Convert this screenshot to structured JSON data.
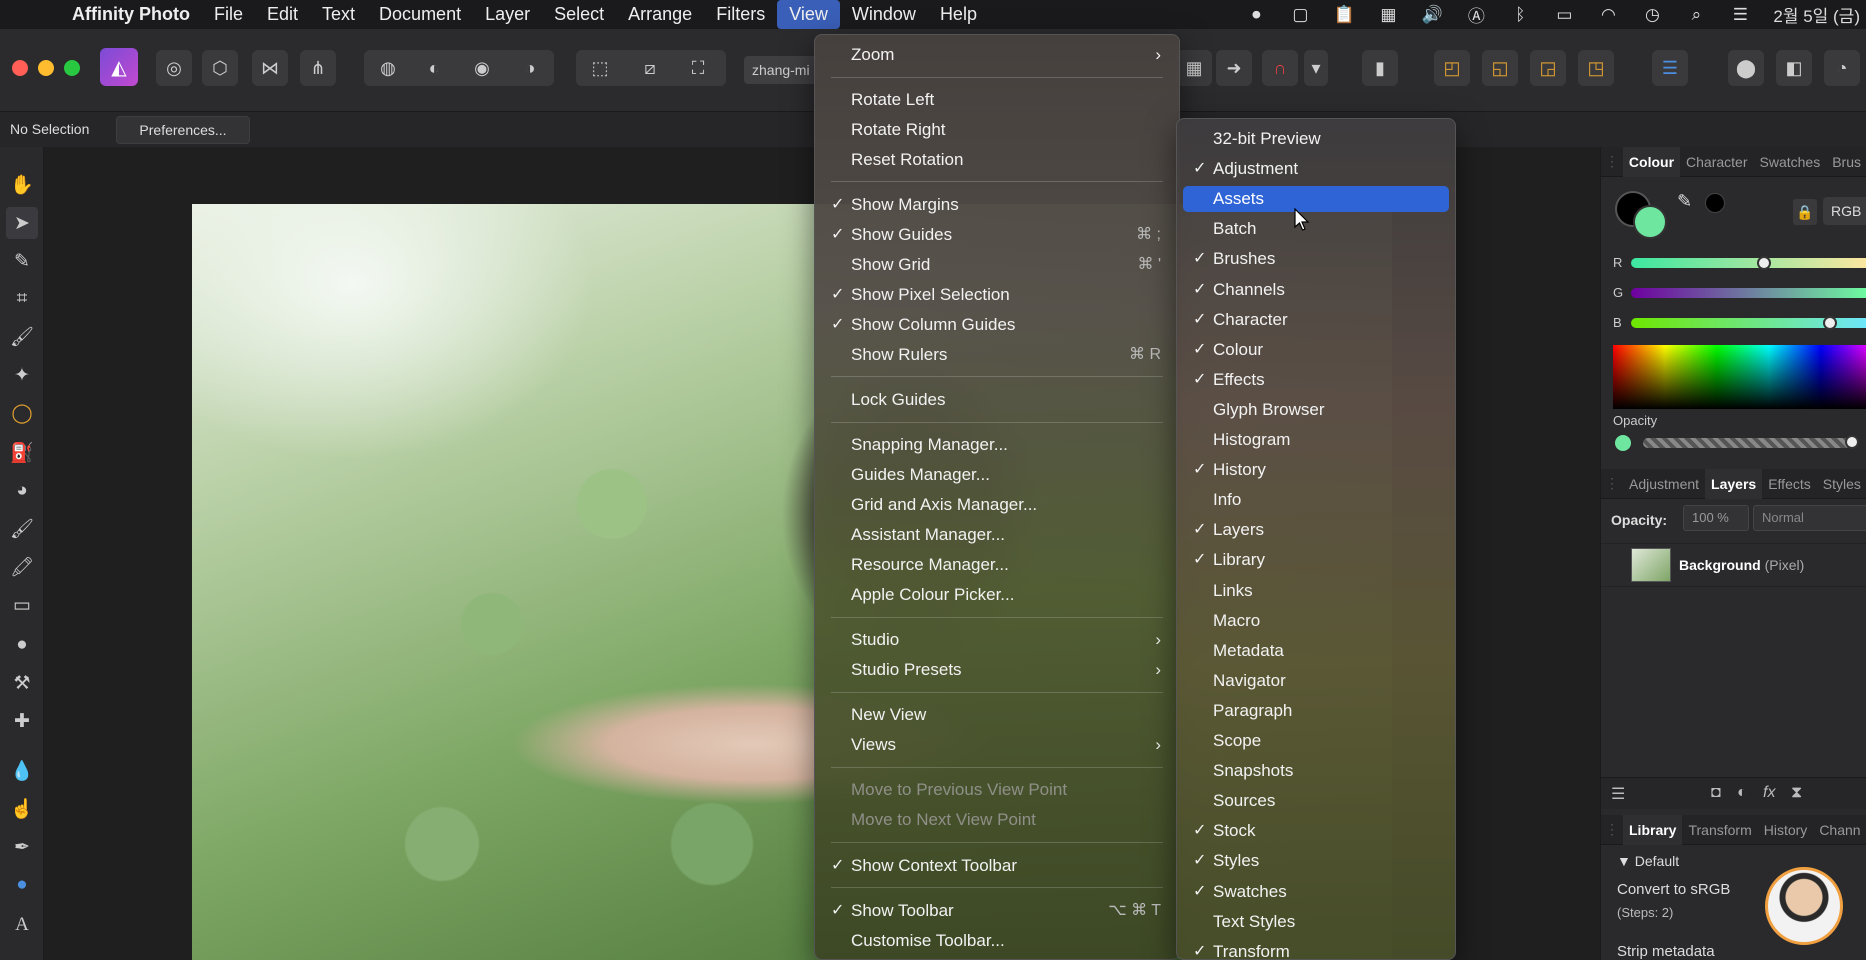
{
  "menubar": {
    "app": "Affinity Photo",
    "items": [
      "File",
      "Edit",
      "Text",
      "Document",
      "Layer",
      "Select",
      "Arrange",
      "Filters",
      "View",
      "Window",
      "Help"
    ],
    "active": "View",
    "date": "2월 5일 (금)"
  },
  "toolbar": {
    "doc_name": "zhang-mi"
  },
  "context": {
    "selection": "No Selection",
    "preferences": "Preferences..."
  },
  "view_menu": {
    "zoom": "Zoom",
    "rotate_left": "Rotate Left",
    "rotate_right": "Rotate Right",
    "reset_rotation": "Reset Rotation",
    "show_margins": "Show Margins",
    "show_guides": "Show Guides",
    "show_guides_sc": "⌘ ;",
    "show_grid": "Show Grid",
    "show_grid_sc": "⌘ '",
    "show_pixel_selection": "Show Pixel Selection",
    "show_column_guides": "Show Column Guides",
    "show_rulers": "Show Rulers",
    "show_rulers_sc": "⌘ R",
    "lock_guides": "Lock Guides",
    "snapping_manager": "Snapping Manager...",
    "guides_manager": "Guides Manager...",
    "grid_axis_manager": "Grid and Axis Manager...",
    "assistant_manager": "Assistant Manager...",
    "resource_manager": "Resource Manager...",
    "apple_colour_picker": "Apple Colour Picker...",
    "studio": "Studio",
    "studio_presets": "Studio Presets",
    "new_view": "New View",
    "views": "Views",
    "move_prev": "Move to Previous View Point",
    "move_next": "Move to Next View Point",
    "show_context_toolbar": "Show Context Toolbar",
    "show_toolbar": "Show Toolbar",
    "show_toolbar_sc": "⌥ ⌘ T",
    "customise_toolbar": "Customise Toolbar..."
  },
  "studio_menu": {
    "items": [
      {
        "label": "32-bit Preview",
        "checked": false
      },
      {
        "label": "Adjustment",
        "checked": true
      },
      {
        "label": "Assets",
        "checked": false,
        "highlighted": true
      },
      {
        "label": "Batch",
        "checked": false
      },
      {
        "label": "Brushes",
        "checked": true
      },
      {
        "label": "Channels",
        "checked": true
      },
      {
        "label": "Character",
        "checked": true
      },
      {
        "label": "Colour",
        "checked": true
      },
      {
        "label": "Effects",
        "checked": true
      },
      {
        "label": "Glyph Browser",
        "checked": false
      },
      {
        "label": "Histogram",
        "checked": false
      },
      {
        "label": "History",
        "checked": true
      },
      {
        "label": "Info",
        "checked": false
      },
      {
        "label": "Layers",
        "checked": true
      },
      {
        "label": "Library",
        "checked": true
      },
      {
        "label": "Links",
        "checked": false
      },
      {
        "label": "Macro",
        "checked": false
      },
      {
        "label": "Metadata",
        "checked": false
      },
      {
        "label": "Navigator",
        "checked": false
      },
      {
        "label": "Paragraph",
        "checked": false
      },
      {
        "label": "Scope",
        "checked": false
      },
      {
        "label": "Snapshots",
        "checked": false
      },
      {
        "label": "Sources",
        "checked": false
      },
      {
        "label": "Stock",
        "checked": true
      },
      {
        "label": "Styles",
        "checked": true
      },
      {
        "label": "Swatches",
        "checked": true
      },
      {
        "label": "Text Styles",
        "checked": false
      },
      {
        "label": "Transform",
        "checked": true
      }
    ]
  },
  "colour_panel": {
    "tabs": [
      "Colour",
      "Character",
      "Swatches",
      "Brus"
    ],
    "mode": "RGB",
    "r_label": "R",
    "g_label": "G",
    "b_label": "B",
    "opacity_label": "Opacity",
    "fill_color": "#6ee6a0"
  },
  "layers_panel": {
    "tabs": [
      "Adjustment",
      "Layers",
      "Effects",
      "Styles"
    ],
    "opacity_label": "Opacity:",
    "opacity_value": "100 %",
    "blend_mode": "Normal",
    "layer_name": "Background",
    "layer_type": "(Pixel)"
  },
  "library_panel": {
    "tabs": [
      "Library",
      "Transform",
      "History",
      "Chann"
    ],
    "group": "Default",
    "item1": "Convert to sRGB",
    "item1_sub": "(Steps: 2)",
    "item2": "Strip metadata"
  }
}
